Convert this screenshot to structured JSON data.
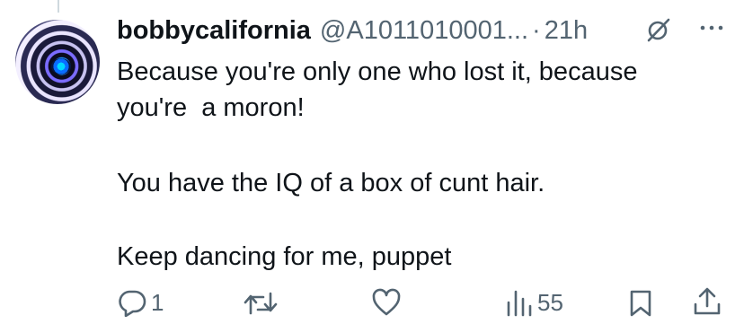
{
  "tweet": {
    "display_name": "bobbycalifornia",
    "handle": "@A1011010001...",
    "separator": "·",
    "time": "21h",
    "lines": [
      "Because you're only one who lost it, because",
      "you're  a moron!",
      "You have the IQ of a box of cunt hair.",
      "Keep dancing for me, puppet"
    ]
  },
  "actions": {
    "reply_count": "1",
    "views_count": "55"
  },
  "colors": {
    "text": "#0f1419",
    "muted": "#536471",
    "thread_line": "#cfd9de"
  },
  "icons": [
    "grok-icon",
    "more-icon",
    "reply-icon",
    "retweet-icon",
    "like-icon",
    "views-icon",
    "bookmark-icon",
    "share-icon"
  ]
}
